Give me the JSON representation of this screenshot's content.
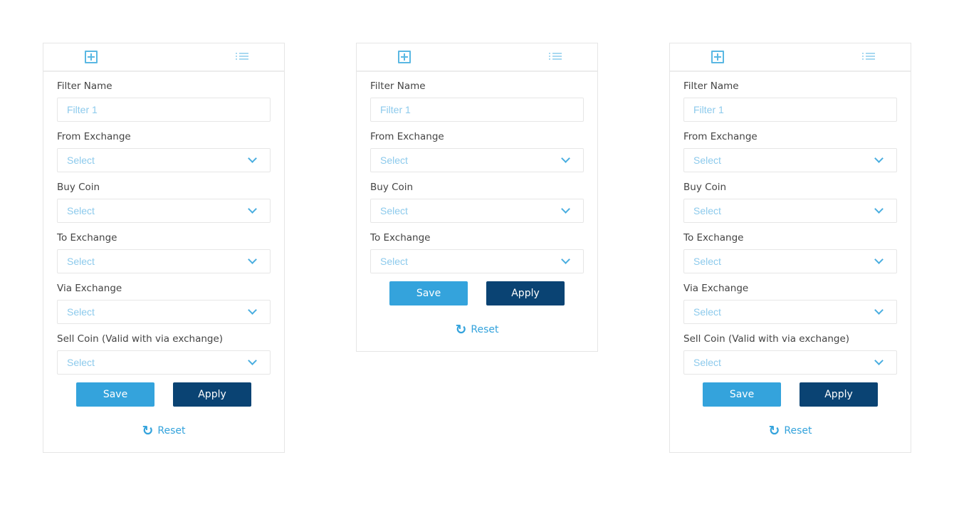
{
  "colors": {
    "accent": "#34a3dc",
    "primary_dark": "#0a4373",
    "placeholder": "#8ccaec"
  },
  "panels": [
    {
      "tabs": {
        "add_icon": "plus-square-icon",
        "list_icon": "list-icon"
      },
      "fields": [
        {
          "label": "Filter Name",
          "type": "text",
          "placeholder": "Filter 1"
        },
        {
          "label": "From Exchange",
          "type": "select",
          "value": "Select"
        },
        {
          "label": "Buy Coin",
          "type": "select",
          "value": "Select"
        },
        {
          "label": "To Exchange",
          "type": "select",
          "value": "Select"
        },
        {
          "label": "Via Exchange",
          "type": "select",
          "value": "Select"
        },
        {
          "label": "Sell Coin (Valid with via exchange)",
          "type": "select",
          "value": "Select"
        }
      ],
      "save_label": "Save",
      "apply_label": "Apply",
      "reset_label": "Reset"
    },
    {
      "tabs": {
        "add_icon": "plus-square-icon",
        "list_icon": "list-icon"
      },
      "fields": [
        {
          "label": "Filter Name",
          "type": "text",
          "placeholder": "Filter 1"
        },
        {
          "label": "From Exchange",
          "type": "select",
          "value": "Select"
        },
        {
          "label": "Buy Coin",
          "type": "select",
          "value": "Select"
        },
        {
          "label": "To Exchange",
          "type": "select",
          "value": "Select"
        }
      ],
      "save_label": "Save",
      "apply_label": "Apply",
      "reset_label": "Reset"
    },
    {
      "tabs": {
        "add_icon": "plus-square-icon",
        "list_icon": "list-icon"
      },
      "fields": [
        {
          "label": "Filter Name",
          "type": "text",
          "placeholder": "Filter 1"
        },
        {
          "label": "From Exchange",
          "type": "select",
          "value": "Select"
        },
        {
          "label": "Buy Coin",
          "type": "select",
          "value": "Select"
        },
        {
          "label": "To Exchange",
          "type": "select",
          "value": "Select"
        },
        {
          "label": "Via Exchange",
          "type": "select",
          "value": "Select"
        },
        {
          "label": "Sell Coin (Valid with via exchange)",
          "type": "select",
          "value": "Select"
        }
      ],
      "save_label": "Save",
      "apply_label": "Apply",
      "reset_label": "Reset"
    }
  ]
}
